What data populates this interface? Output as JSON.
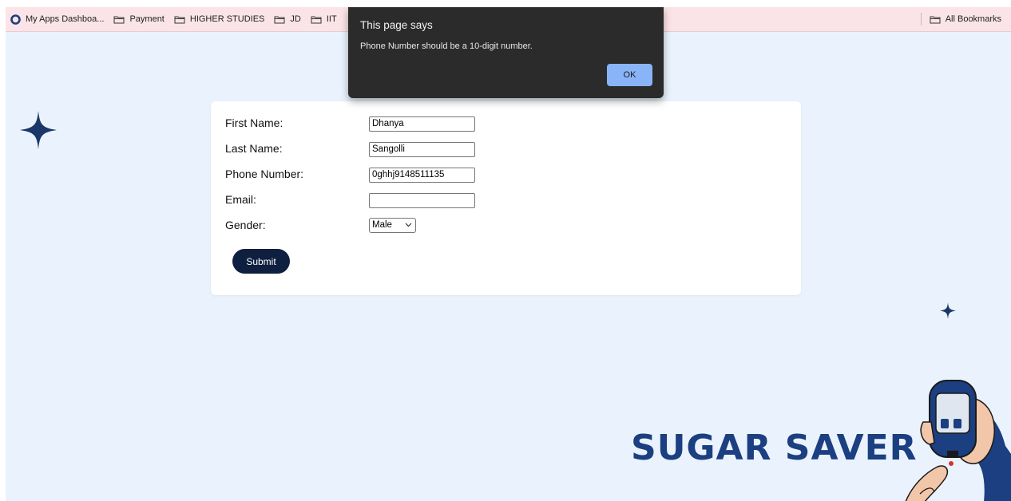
{
  "bookmarks": {
    "items": [
      {
        "label": "My Apps Dashboa...",
        "icon": "app-circle-icon"
      },
      {
        "label": "Payment",
        "icon": "folder-icon"
      },
      {
        "label": "HIGHER STUDIES",
        "icon": "folder-icon"
      },
      {
        "label": "JD",
        "icon": "folder-icon"
      },
      {
        "label": "IIT",
        "icon": "folder-icon"
      }
    ],
    "all_bookmarks": "All Bookmarks"
  },
  "dialog": {
    "title": "This page says",
    "message": "Phone Number should be a 10-digit number.",
    "ok_label": "OK"
  },
  "form": {
    "first_name_label": "First Name:",
    "first_name_value": "Dhanya",
    "last_name_label": "Last Name:",
    "last_name_value": "Sangolli",
    "phone_label": "Phone Number:",
    "phone_value": "0ghhj9148511135",
    "email_label": "Email:",
    "email_value": "",
    "gender_label": "Gender:",
    "gender_value": "Male",
    "submit_label": "Submit"
  },
  "brand": {
    "name": "SUGAR SAVER"
  },
  "colors": {
    "page_bg": "#eaf3fd",
    "bookmarks_bg": "#fbe4e7",
    "submit_bg": "#0e1f3f",
    "brand": "#1b3f80",
    "dialog_bg": "#2b2b2b",
    "ok_button": "#8ab4f8"
  }
}
